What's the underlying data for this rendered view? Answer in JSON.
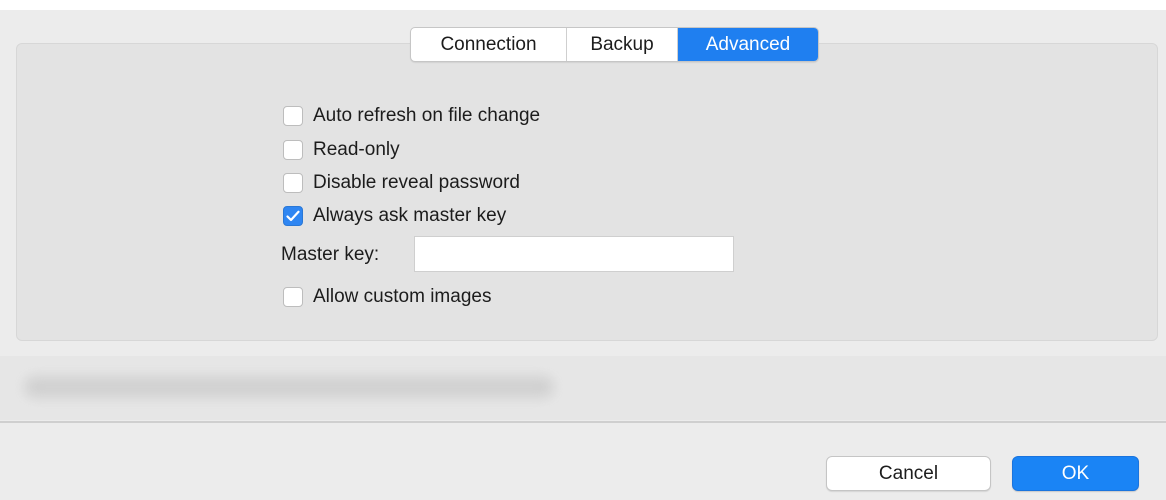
{
  "tabs": [
    {
      "label": "Connection",
      "selected": false
    },
    {
      "label": "Backup",
      "selected": false
    },
    {
      "label": "Advanced",
      "selected": true
    }
  ],
  "options": [
    {
      "label": "Auto refresh on file change",
      "checked": false
    },
    {
      "label": "Read-only",
      "checked": false
    },
    {
      "label": "Disable reveal password",
      "checked": false
    },
    {
      "label": "Always ask master key",
      "checked": true
    },
    {
      "label": "Allow custom images",
      "checked": false
    }
  ],
  "master_key": {
    "label": "Master key:",
    "value": "",
    "placeholder": ""
  },
  "buttons": {
    "cancel": "Cancel",
    "ok": "OK"
  },
  "colors": {
    "accent": "#1f7ff0",
    "panel": "#e3e3e3",
    "background": "#ececec"
  }
}
